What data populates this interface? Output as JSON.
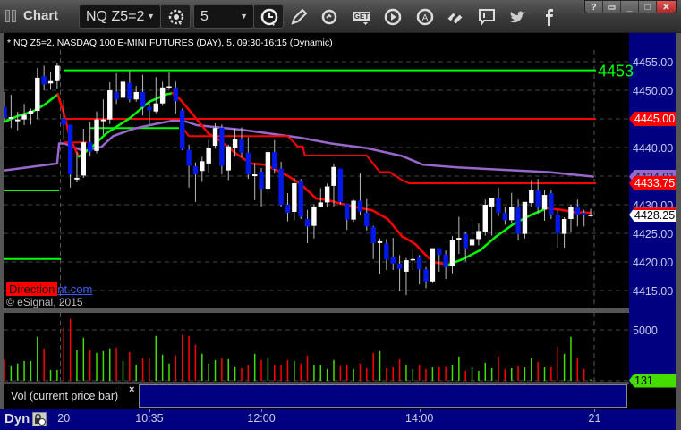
{
  "window": {
    "title": "Chart",
    "symbol": "NQ Z5=2",
    "interval": "5",
    "toolbar_icons": [
      "symbol-settings-icon",
      "interval-clock-icon",
      "pencil-icon",
      "refresh-icon",
      "get-icon",
      "play-icon",
      "a-icon",
      "link-icon",
      "comment-icon",
      "twitter-icon",
      "facebook-icon"
    ],
    "window_buttons": {
      "help": "?",
      "minimize": "_",
      "maximize": "□",
      "close": "✕"
    }
  },
  "chart_info": "* NQ Z5=2, NASDAQ 100 E-MINI FUTURES (DAY), 5, 09:30-16:15 (Dynamic)",
  "watermark": {
    "brand_box": "Direction",
    "link_fragment": "nt.com",
    "copyright": "© eSignal, 2015"
  },
  "volume_panel": {
    "label": "Vol (current price bar)",
    "close": "×"
  },
  "bottom_bar": {
    "mode": "Dyn"
  },
  "colors": {
    "up_candle": "#ffffff",
    "down_candle": "#0018e8",
    "up_volume": "#44dd00",
    "down_volume": "#ff0000",
    "axis_bg": "#000080",
    "ema_up": "#00ff00",
    "ema_down": "#ff0000",
    "vwap": "#9966cc",
    "level_red": "#ff0000",
    "level_green": "#00ff00"
  },
  "chart_data": {
    "type": "candlestick",
    "ylim": [
      4412,
      4460
    ],
    "y_ticks": [
      "4455.00",
      "4450.00",
      "4445.00",
      "4440.00",
      "4435.00",
      "4430.00",
      "4425.00",
      "4420.00",
      "4415.00"
    ],
    "y_tick_values": [
      4455,
      4450,
      4445,
      4440,
      4435,
      4430,
      4425,
      4420,
      4415
    ],
    "grid": true,
    "x_labels": [
      {
        "label": "20",
        "bar": 10
      },
      {
        "label": "10:35",
        "bar": 23
      },
      {
        "label": "12:00",
        "bar": 40
      },
      {
        "label": "14:00",
        "bar": 64
      },
      {
        "label": "21",
        "bar": 90.6
      }
    ],
    "candles_ohlc": [
      [
        4447.1,
        4449.7,
        4444.7,
        4445.2
      ],
      [
        4445.0,
        4449.2,
        4443.4,
        4445.3
      ],
      [
        4444.6,
        4446.25,
        4443.0,
        4444.9
      ],
      [
        4444.9,
        4447.6,
        4443.9,
        4445.7
      ],
      [
        4445.9,
        4446.8,
        4444.0,
        4446.4
      ],
      [
        4446.4,
        4453.9,
        4445.0,
        4452.2
      ],
      [
        4452.5,
        4454.3,
        4450.0,
        4451.0
      ],
      [
        4451.2,
        4453.2,
        4450.1,
        4451.6
      ],
      [
        4451.6,
        4454.8,
        4450.3,
        4454.3
      ],
      [
        4445.0,
        4448.3,
        4441.3,
        4444.0
      ],
      [
        4444.0,
        4444.0,
        4433.0,
        4435.3
      ],
      [
        4434.4,
        4439.2,
        4433.9,
        4434.7
      ],
      [
        4435.1,
        4443.3,
        4434.7,
        4440.9
      ],
      [
        4440.9,
        4444.5,
        4438.5,
        4439.3
      ],
      [
        4439.4,
        4446.3,
        4439.0,
        4444.9
      ],
      [
        4444.6,
        4448.4,
        4442.2,
        4444.9
      ],
      [
        4444.9,
        4451.4,
        4444.1,
        4450.0
      ],
      [
        4449.7,
        4453.0,
        4447.6,
        4448.4
      ],
      [
        4448.7,
        4453.0,
        4447.3,
        4451.5
      ],
      [
        4451.3,
        4453.4,
        4447.9,
        4448.4
      ],
      [
        4448.4,
        4450.8,
        4448.0,
        4449.7
      ],
      [
        4449.7,
        4452.7,
        4445.6,
        4447.1
      ],
      [
        4447.1,
        4448.0,
        4444.0,
        4446.5
      ],
      [
        4446.3,
        4452.3,
        4446.0,
        4447.7
      ],
      [
        4447.7,
        4451.5,
        4447.3,
        4450.5
      ],
      [
        4450.5,
        4453.2,
        4450.1,
        4450.7
      ],
      [
        4450.5,
        4451.5,
        4445.9,
        4448.1
      ],
      [
        4446.5,
        4446.8,
        4439.5,
        4439.7
      ],
      [
        4439.6,
        4440.5,
        4433.0,
        4436.8
      ],
      [
        4436.7,
        4437.4,
        4430.5,
        4435.3
      ],
      [
        4435.9,
        4438.4,
        4434.0,
        4437.6
      ],
      [
        4437.2,
        4441.3,
        4435.5,
        4440.0
      ],
      [
        4440.3,
        4444.2,
        4439.8,
        4443.4
      ],
      [
        4443.5,
        4444.0,
        4435.3,
        4436.8
      ],
      [
        4436.0,
        4440.5,
        4434.3,
        4440.2
      ],
      [
        4440.0,
        4443.3,
        4438.4,
        4441.4
      ],
      [
        4441.4,
        4443.5,
        4438.3,
        4439.1
      ],
      [
        4439.1,
        4441.8,
        4434.5,
        4435.3
      ],
      [
        4435.0,
        4437.2,
        4430.8,
        4435.3
      ],
      [
        4435.8,
        4436.4,
        4429.7,
        4432.8
      ],
      [
        4432.8,
        4440.0,
        4432.0,
        4439.2
      ],
      [
        4439.2,
        4441.3,
        4435.5,
        4436.25
      ],
      [
        4436.3,
        4437.5,
        4429.7,
        4430.0
      ],
      [
        4430.0,
        4432.0,
        4427.1,
        4428.6
      ],
      [
        4428.75,
        4434.7,
        4427.3,
        4433.75
      ],
      [
        4434.2,
        4434.5,
        4427.5,
        4427.9
      ],
      [
        4427.5,
        4429.1,
        4423.3,
        4426.2
      ],
      [
        4426.3,
        4430.1,
        4424.1,
        4429.7
      ],
      [
        4429.7,
        4432.9,
        4429.5,
        4430.4
      ],
      [
        4430.4,
        4433.7,
        4429.5,
        4433.2
      ],
      [
        4433.3,
        4437.2,
        4429.7,
        4436.6
      ],
      [
        4436.3,
        4436.3,
        4430.0,
        4430.5
      ],
      [
        4430.2,
        4430.2,
        4425.6,
        4427.4
      ],
      [
        4427.4,
        4430.9,
        4427.0,
        4430.7
      ],
      [
        4430.7,
        4435.5,
        4428.2,
        4428.8
      ],
      [
        4428.6,
        4431.0,
        4425.5,
        4426.2
      ],
      [
        4426.1,
        4426.3,
        4420.5,
        4423.3
      ],
      [
        4423.3,
        4424.1,
        4417.9,
        4423.6
      ],
      [
        4423.2,
        4424.0,
        4418.6,
        4420.4
      ],
      [
        4420.8,
        4424.2,
        4418.6,
        4419.7
      ],
      [
        4419.7,
        4421.2,
        4414.9,
        4418.8
      ],
      [
        4418.3,
        4420.7,
        4414.2,
        4420.3
      ],
      [
        4420.3,
        4422.3,
        4418.6,
        4420.5
      ],
      [
        4420.8,
        4421.2,
        4416.1,
        4418.7
      ],
      [
        4418.7,
        4419.1,
        4415.4,
        4416.6
      ],
      [
        4416.6,
        4422.4,
        4416.3,
        4422.4
      ],
      [
        4422.4,
        4422.4,
        4418.3,
        4421.25
      ],
      [
        4421.3,
        4422.0,
        4417.0,
        4419.1
      ],
      [
        4419.3,
        4424.5,
        4418.0,
        4423.75
      ],
      [
        4423.9,
        4427.9,
        4421.4,
        4424.2
      ],
      [
        4424.9,
        4425.3,
        4420.1,
        4422.4
      ],
      [
        4422.9,
        4427.5,
        4422.4,
        4424.0
      ],
      [
        4424.0,
        4426.7,
        4422.9,
        4425.4
      ],
      [
        4425.3,
        4430.9,
        4424.6,
        4430.0
      ],
      [
        4429.7,
        4431.25,
        4424.6,
        4431.25
      ],
      [
        4431.25,
        4433.0,
        4428.0,
        4428.6
      ],
      [
        4428.6,
        4429.6,
        4426.5,
        4427.3
      ],
      [
        4427.3,
        4432.1,
        4426.7,
        4429.6
      ],
      [
        4429.6,
        4430.9,
        4423.75,
        4424.9
      ],
      [
        4424.9,
        4430.5,
        4424.1,
        4430.5
      ],
      [
        4430.3,
        4434.3,
        4429.6,
        4432.5
      ],
      [
        4432.5,
        4434.5,
        4428.4,
        4429.5
      ],
      [
        4429.2,
        4432.5,
        4427.2,
        4431.7
      ],
      [
        4432.0,
        4432.6,
        4427.5,
        4428.3
      ],
      [
        4428.3,
        4429.1,
        4422.5,
        4425.0
      ],
      [
        4424.9,
        4427.8,
        4422.5,
        4427.5
      ],
      [
        4427.5,
        4430.0,
        4425.2,
        4429.6
      ],
      [
        4429.6,
        4430.9,
        4426.2,
        4428.3
      ],
      [
        4428.6,
        4429.1,
        4426.2,
        4428.3
      ],
      [
        4428.0,
        4429.3,
        4427.9,
        4428.25
      ]
    ],
    "volume": [
      2090,
      1500,
      1680,
      1940,
      1940,
      4320,
      3180,
      1060,
      1060,
      5200,
      6090,
      3000,
      4230,
      3000,
      2730,
      2910,
      3180,
      3260,
      1940,
      2820,
      1590,
      2200,
      2290,
      4410,
      2560,
      1680,
      2470,
      4500,
      4410,
      3530,
      2650,
      1680,
      2030,
      2200,
      2120,
      1410,
      1230,
      1590,
      2650,
      2030,
      2290,
      1590,
      1590,
      2030,
      1940,
      1680,
      2470,
      1590,
      1590,
      1150,
      2030,
      1500,
      1590,
      1150,
      1680,
      1230,
      2730,
      2910,
      1230,
      1320,
      2120,
      1590,
      1150,
      1590,
      1150,
      1320,
      1410,
      1410,
      1590,
      2380,
      970,
      1320,
      970,
      1760,
      1230,
      2380,
      1150,
      1230,
      1500,
      1320,
      2290,
      1850,
      1320,
      1410,
      3350,
      2650,
      4320,
      2290,
      1150,
      131
    ],
    "volume_up": [
      0,
      1,
      1,
      1,
      1,
      1,
      0,
      1,
      1,
      0,
      0,
      1,
      1,
      0,
      1,
      1,
      1,
      0,
      1,
      0,
      1,
      0,
      0,
      1,
      1,
      1,
      0,
      0,
      0,
      0,
      1,
      1,
      1,
      0,
      1,
      1,
      0,
      0,
      1,
      0,
      1,
      0,
      0,
      0,
      1,
      0,
      0,
      1,
      1,
      1,
      1,
      0,
      0,
      1,
      0,
      0,
      0,
      1,
      0,
      0,
      0,
      1,
      1,
      0,
      0,
      1,
      0,
      0,
      1,
      1,
      0,
      1,
      1,
      1,
      1,
      0,
      0,
      1,
      0,
      1,
      1,
      0,
      1,
      0,
      0,
      1,
      1,
      0,
      0,
      1
    ],
    "volume_ticks": [
      "5000"
    ],
    "volume_tick_values": [
      5000
    ],
    "volume_current": "131",
    "ema_line": [
      [
        1,
        4444.5
      ],
      [
        3,
        4445.5
      ],
      [
        5.3,
        4446.3
      ],
      [
        7.1,
        4447.5
      ],
      [
        9.1,
        4449.3
      ],
      [
        10,
        4446
      ],
      [
        11,
        4441.5
      ],
      [
        12.3,
        4438.4
      ],
      [
        14,
        4439.8
      ],
      [
        16.5,
        4442.5
      ],
      [
        20,
        4445.1
      ],
      [
        23,
        4448
      ],
      [
        25.6,
        4449.3
      ],
      [
        26.5,
        4449.5
      ],
      [
        27.6,
        4448.5
      ],
      [
        29.5,
        4445.9
      ],
      [
        31,
        4443.8
      ],
      [
        32,
        4442.4
      ],
      [
        33,
        4441.8
      ],
      [
        34.4,
        4440.6
      ],
      [
        36.1,
        4439
      ],
      [
        38.4,
        4437.2
      ],
      [
        40.6,
        4437
      ],
      [
        43.8,
        4435.2
      ],
      [
        46,
        4433.6
      ],
      [
        48.3,
        4431.1
      ],
      [
        50.1,
        4430.8
      ],
      [
        51.7,
        4430.3
      ],
      [
        54.6,
        4429.5
      ],
      [
        56.9,
        4429
      ],
      [
        59.2,
        4427.5
      ],
      [
        61.4,
        4424.4
      ],
      [
        62,
        4424.1
      ],
      [
        63.4,
        4423.1
      ],
      [
        64.7,
        4421.5
      ],
      [
        66.1,
        4420
      ],
      [
        68.4,
        4419.5
      ],
      [
        70.6,
        4420.5
      ],
      [
        73.3,
        4422.1
      ],
      [
        75.6,
        4424.4
      ],
      [
        78.4,
        4426.7
      ],
      [
        81.1,
        4428.3
      ],
      [
        83.4,
        4429.4
      ],
      [
        85.6,
        4429.1
      ],
      [
        87.4,
        4428.7
      ],
      [
        90,
        4428.6
      ]
    ],
    "vwap_line": [
      [
        1,
        4436
      ],
      [
        9,
        4437.2
      ],
      [
        9.3,
        4440.7
      ],
      [
        10.1,
        4440.7
      ],
      [
        13,
        4439.4
      ],
      [
        15.7,
        4440.1
      ],
      [
        17.5,
        4442
      ],
      [
        20.7,
        4443.3
      ],
      [
        23.9,
        4444.1
      ],
      [
        26.6,
        4444.7
      ],
      [
        28.4,
        4444.6
      ],
      [
        30.2,
        4443.9
      ],
      [
        37,
        4443.1
      ],
      [
        41.5,
        4442.4
      ],
      [
        46,
        4441.7
      ],
      [
        50.6,
        4440.7
      ],
      [
        56,
        4439.9
      ],
      [
        61.4,
        4438.5
      ],
      [
        64.5,
        4437
      ],
      [
        70,
        4436.5
      ],
      [
        76.8,
        4436.1
      ],
      [
        83.6,
        4435.7
      ],
      [
        90.5,
        4434.91
      ]
    ],
    "trail_stop_line": [
      [
        [
          10,
          4440.9
        ],
        [
          13.5,
          4440.9
        ]
      ],
      [
        [
          28,
          4443.5
        ],
        [
          29,
          4442
        ],
        [
          44,
          4442
        ],
        [
          45.5,
          4440.2
        ],
        [
          46.3,
          4440.2
        ],
        [
          46.6,
          4438.6
        ],
        [
          56,
          4438.6
        ],
        [
          58,
          4435.7
        ],
        [
          59.5,
          4435.7
        ],
        [
          61.5,
          4434.2
        ],
        [
          62.5,
          4433.75
        ],
        [
          90.8,
          4433.75
        ]
      ]
    ],
    "levels": [
      {
        "price": 4453.5,
        "from": 10,
        "to": 90.8,
        "color": "#00ff00",
        "label": "4453"
      },
      {
        "price": 4445.0,
        "from": 10,
        "to": 90.8,
        "color": "#ff0000"
      },
      {
        "price": 4443.4,
        "from": 14,
        "to": 27.5,
        "color": "#00ff00"
      },
      {
        "price": 4432.5,
        "from": 0.9,
        "to": 9.3,
        "color": "#00ff00"
      },
      {
        "price": 4420.5,
        "from": 0.9,
        "to": 9.6,
        "color": "#00ff00"
      }
    ],
    "price_tags": [
      {
        "label": "4445.00",
        "price": 4445.0,
        "bg": "#ff0000",
        "fg": "#ffffff"
      },
      {
        "label": "4434.91",
        "price": 4434.91,
        "bg": "#9966cc",
        "fg": "#222222"
      },
      {
        "label": "4433.75",
        "price": 4433.75,
        "bg": "#ff0000",
        "fg": "#ffffff"
      },
      {
        "label": "4428.25",
        "price": 4428.25,
        "bg": "#ffffff",
        "fg": "#000000"
      }
    ]
  }
}
